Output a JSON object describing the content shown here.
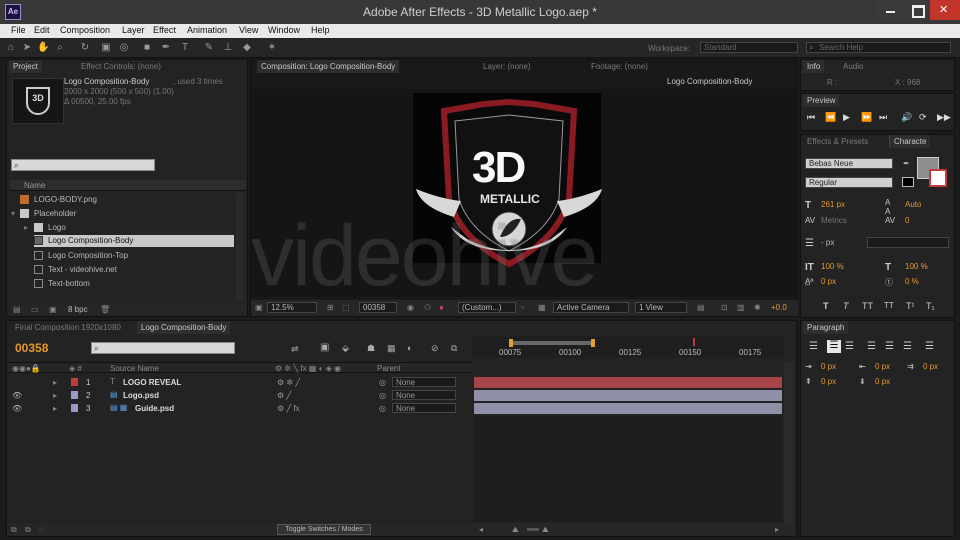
{
  "window": {
    "title": "Adobe After Effects - 3D Metallic Logo.aep *",
    "app_icon": "Ae"
  },
  "menu": [
    "File",
    "Edit",
    "Composition",
    "Layer",
    "Effect",
    "Animation",
    "View",
    "Window",
    "Help"
  ],
  "toolbar": {
    "workspace_label": "Workspace:",
    "workspace_value": "Standard",
    "search_placeholder": "Search Help"
  },
  "project": {
    "tab_project": "Project",
    "tab_effect_controls": "Effect Controls: (none)",
    "comp_name": "Logo Composition-Body",
    "used": ", used 3 times",
    "size": "2000 x 2000 (500 x 500) (1.00)",
    "duration": "Δ 00500, 25.00 fps",
    "column_name": "Name",
    "items": [
      {
        "name": "LOGO-BODY.png",
        "type": "image",
        "indent": 0
      },
      {
        "name": "Placeholder",
        "type": "folder",
        "indent": 0
      },
      {
        "name": "Logo",
        "type": "folder",
        "indent": 1
      },
      {
        "name": "Logo Composition-Body",
        "type": "comp",
        "indent": 1,
        "selected": true
      },
      {
        "name": "Logo Composition-Top",
        "type": "comp",
        "indent": 1
      },
      {
        "name": "Text - videohive.net",
        "type": "comp",
        "indent": 1
      },
      {
        "name": "Text-bottom",
        "type": "comp",
        "indent": 1
      }
    ],
    "bpc": "8 bpc"
  },
  "comp": {
    "tab_comp": "Composition: Logo Composition-Body",
    "tab_layer": "Layer: (none)",
    "tab_footage": "Footage: (none)",
    "breadcrumb_active": "Logo Composition-Body",
    "logo_main": "3D",
    "logo_sub": "METALLIC",
    "watermark": "videohive",
    "zoom": "12.5%",
    "frame": "00358",
    "custom": "(Custom...)",
    "camera": "Active Camera",
    "view": "1 View",
    "exposure": "+0.0"
  },
  "info": {
    "tab_info": "Info",
    "tab_audio": "Audio",
    "r_label": "R :",
    "x_label": "X : 968"
  },
  "preview": {
    "tab": "Preview"
  },
  "character": {
    "tab_effects": "Effects & Presets",
    "tab_character": "Characte",
    "font": "Bebas Neue",
    "style": "Regular",
    "size": "261 px",
    "leading": "Auto",
    "kerning": "Metrics",
    "tracking": "0",
    "stroke": "- px",
    "vscale": "100 %",
    "hscale": "100 %",
    "baseline": "0 px",
    "tsume": "0 %",
    "styles": [
      "T",
      "T",
      "TT",
      "TT",
      "T¹",
      "T₁"
    ]
  },
  "paragraph": {
    "tab": "Paragraph",
    "indent_values": [
      "0 px",
      "0 px",
      "0 px",
      "0 px",
      "0 px"
    ]
  },
  "timeline": {
    "tab_final": "Final Composition 1920x1080",
    "tab_logo": "Logo Composition-Body",
    "timecode": "00358",
    "col_source": "Source Name",
    "col_parent": "Parent",
    "ruler": [
      "00075",
      "00100",
      "00125",
      "00150",
      "00175"
    ],
    "layers": [
      {
        "num": "1",
        "name": "LOGO REVEAL",
        "parent": "None",
        "color": "#c23b3b",
        "bar": "#a8434a"
      },
      {
        "num": "2",
        "name": "Logo.psd",
        "parent": "None",
        "color": "#9b9bc8",
        "bar": "#8f8fa8"
      },
      {
        "num": "3",
        "name": "Guide.psd",
        "parent": "None",
        "color": "#9b9bc8",
        "bar": "#8f8fa8"
      }
    ],
    "toggle_label": "Toggle Switches / Modes"
  }
}
